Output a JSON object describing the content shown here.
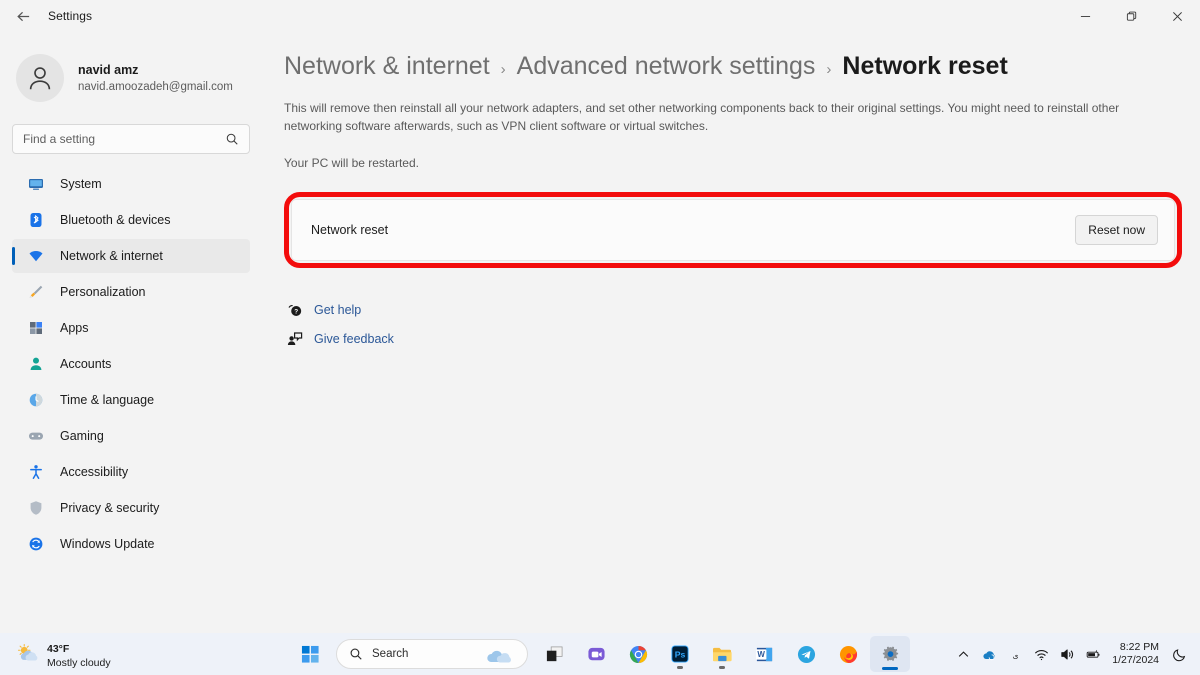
{
  "window": {
    "title": "Settings",
    "back_icon": "back-arrow-icon",
    "minimize_label": "Minimize",
    "maximize_label": "Maximize",
    "close_label": "Close"
  },
  "sidebar": {
    "profile": {
      "name": "navid amz",
      "email": "navid.amoozadeh@gmail.com",
      "avatar_icon": "person-avatar-icon"
    },
    "search": {
      "placeholder": "Find a setting",
      "icon": "search-icon",
      "value": ""
    },
    "items": [
      {
        "label": "System",
        "icon": "system-monitor-icon",
        "active": false
      },
      {
        "label": "Bluetooth & devices",
        "icon": "bluetooth-icon",
        "active": false
      },
      {
        "label": "Network & internet",
        "icon": "network-wifi-icon",
        "active": true
      },
      {
        "label": "Personalization",
        "icon": "paintbrush-icon",
        "active": false
      },
      {
        "label": "Apps",
        "icon": "apps-grid-icon",
        "active": false
      },
      {
        "label": "Accounts",
        "icon": "account-person-icon",
        "active": false
      },
      {
        "label": "Time & language",
        "icon": "clock-globe-icon",
        "active": false
      },
      {
        "label": "Gaming",
        "icon": "gamepad-icon",
        "active": false
      },
      {
        "label": "Accessibility",
        "icon": "accessibility-person-icon",
        "active": false
      },
      {
        "label": "Privacy & security",
        "icon": "shield-icon",
        "active": false
      },
      {
        "label": "Windows Update",
        "icon": "update-refresh-icon",
        "active": false
      }
    ]
  },
  "main": {
    "breadcrumb": [
      {
        "label": "Network & internet",
        "current": false
      },
      {
        "label": "Advanced network settings",
        "current": false
      },
      {
        "label": "Network reset",
        "current": true
      }
    ],
    "breadcrumb_separator": "›",
    "description": "This will remove then reinstall all your network adapters, and set other networking components back to their original settings. You might need to reinstall other networking software afterwards, such as VPN client software or virtual switches.",
    "description_secondary": "Your PC will be restarted.",
    "reset_card": {
      "label": "Network reset",
      "button_label": "Reset now",
      "highlight_color": "#f30c0c",
      "highlighted": true
    },
    "links": [
      {
        "label": "Get help",
        "icon": "help-question-icon"
      },
      {
        "label": "Give feedback",
        "icon": "feedback-person-icon"
      }
    ],
    "link_color": "#2b5797"
  },
  "taskbar": {
    "weather": {
      "temperature": "43°F",
      "condition": "Mostly cloudy",
      "icon": "sun-behind-cloud-icon"
    },
    "search": {
      "label": "Search",
      "icon": "search-icon"
    },
    "apps": [
      {
        "name": "start-button",
        "icon": "windows-logo-icon",
        "state": "normal"
      },
      {
        "name": "task-view",
        "icon": "task-view-icon",
        "state": "normal"
      },
      {
        "name": "chat",
        "icon": "chat-teams-icon",
        "state": "normal"
      },
      {
        "name": "chrome",
        "icon": "chrome-icon",
        "state": "normal"
      },
      {
        "name": "photoshop",
        "icon": "photoshop-icon",
        "state": "running"
      },
      {
        "name": "file-explorer",
        "icon": "file-explorer-icon",
        "state": "running"
      },
      {
        "name": "word",
        "icon": "word-icon",
        "state": "normal"
      },
      {
        "name": "telegram",
        "icon": "telegram-icon",
        "state": "normal"
      },
      {
        "name": "firefox",
        "icon": "firefox-icon",
        "state": "normal"
      },
      {
        "name": "settings",
        "icon": "settings-gear-icon",
        "state": "active"
      }
    ],
    "tray": [
      {
        "name": "show-hidden-icons",
        "icon": "chevron-up-icon"
      },
      {
        "name": "onedrive",
        "icon": "onedrive-cloud-icon"
      },
      {
        "name": "language-indicator",
        "icon": "language-icon"
      },
      {
        "name": "wifi",
        "icon": "wifi-icon"
      },
      {
        "name": "volume",
        "icon": "speaker-icon"
      },
      {
        "name": "battery",
        "icon": "battery-icon"
      }
    ],
    "clock": {
      "time": "8:22 PM",
      "date": "1/27/2024"
    },
    "notifications": {
      "icon": "moon-do-not-disturb-icon"
    }
  }
}
